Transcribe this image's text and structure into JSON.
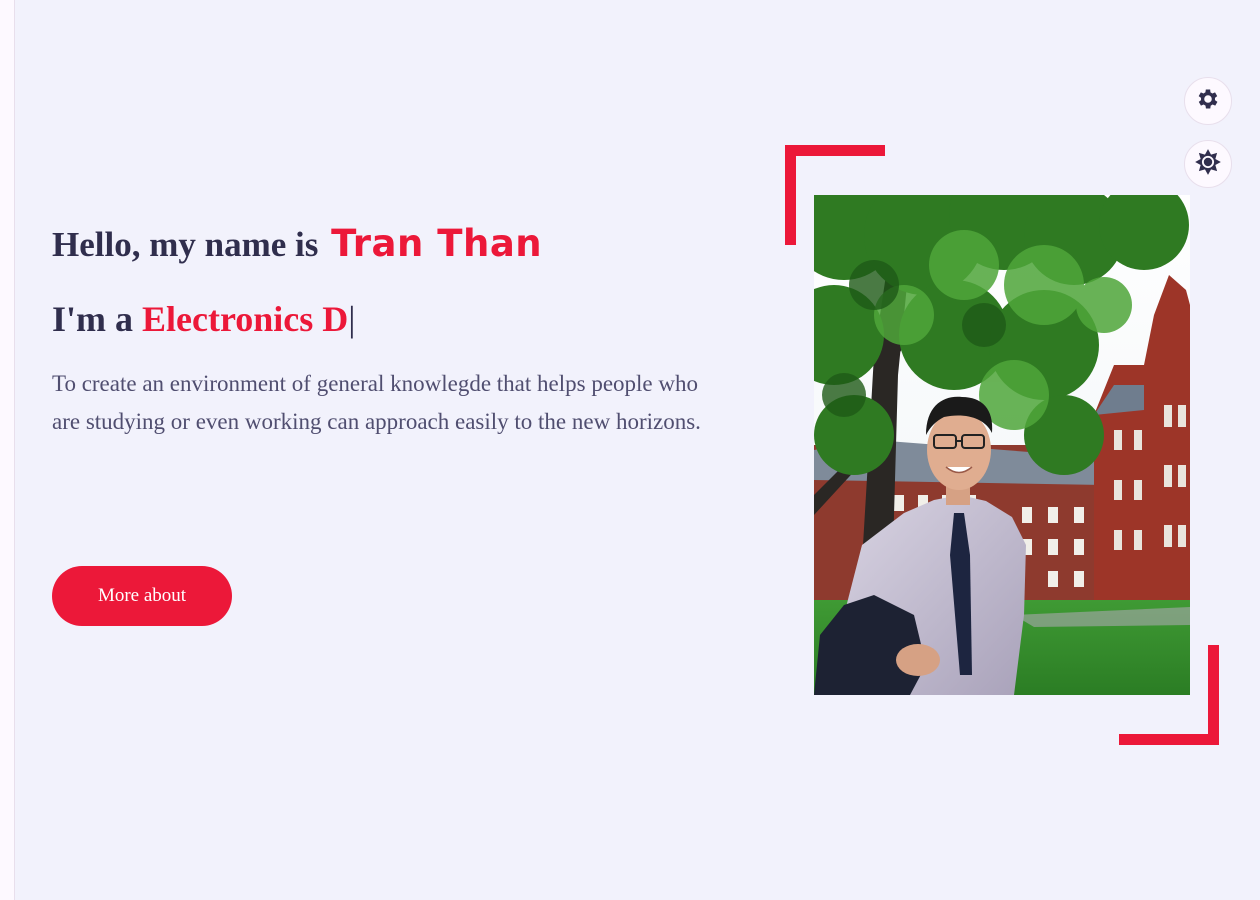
{
  "hero": {
    "greeting_prefix": "Hello, my name is",
    "name": "Tran Than",
    "role_prefix": "I'm a",
    "role_typed": "Electronics D",
    "cursor": "|",
    "description": "To create an environment of general knowlegde that helps people who are studying or even working can approach easily to the new horizons.",
    "button_label": "More about"
  },
  "icons": {
    "settings": "gear-icon",
    "theme_toggle": "sun-icon"
  },
  "colors": {
    "accent": "#ec1839",
    "heading": "#302e4d",
    "text": "#504e70",
    "background": "#f2f2fc"
  }
}
